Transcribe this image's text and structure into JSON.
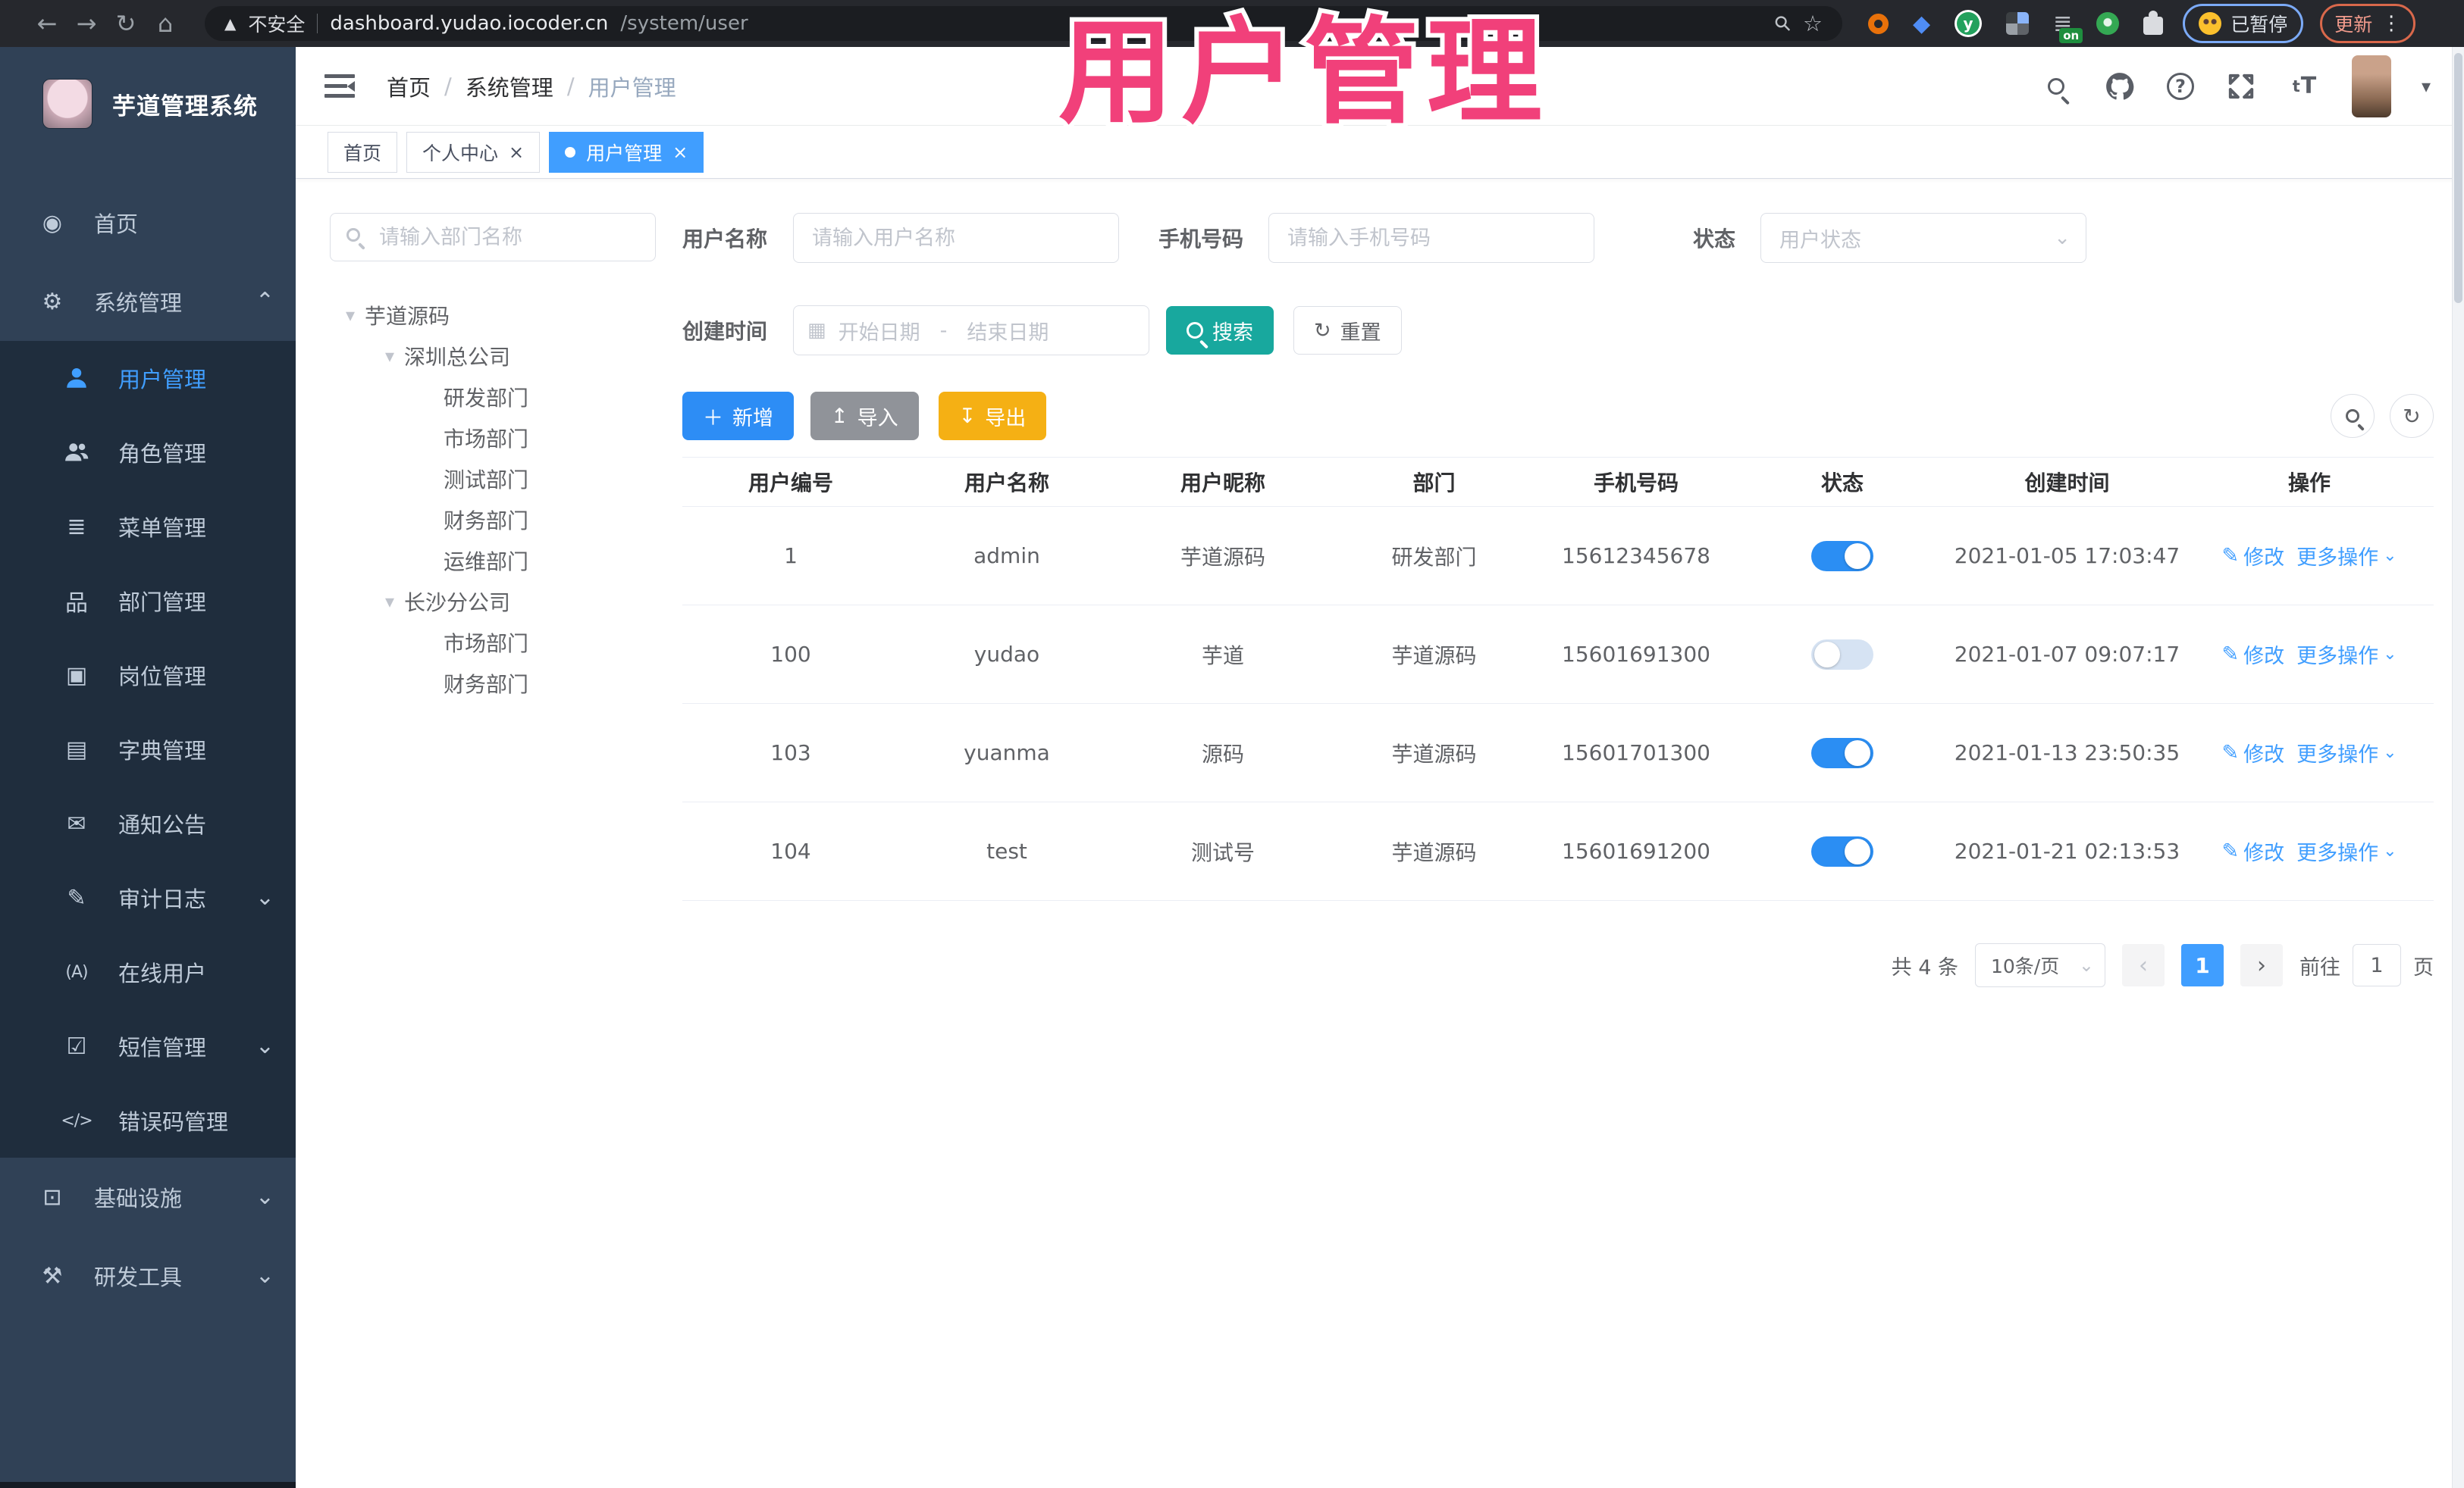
{
  "browser": {
    "security_label": "不安全",
    "url_host": "dashboard.yudao.iocoder.cn",
    "url_path": "/system/user",
    "ext_on_badge": "on",
    "paused_label": "已暂停",
    "update_label": "更新"
  },
  "overlay_title": "用户管理",
  "sidebar": {
    "logo_title": "芋道管理系统",
    "items": [
      {
        "label": "首页",
        "icon": "dashboard-icon",
        "level": 0
      },
      {
        "label": "系统管理",
        "icon": "gear-icon",
        "level": 0,
        "arrow": "up"
      },
      {
        "label": "用户管理",
        "icon": "user-icon",
        "level": 1,
        "active": true
      },
      {
        "label": "角色管理",
        "icon": "users-icon",
        "level": 1
      },
      {
        "label": "菜单管理",
        "icon": "menu-list-icon",
        "level": 1
      },
      {
        "label": "部门管理",
        "icon": "org-tree-icon",
        "level": 1
      },
      {
        "label": "岗位管理",
        "icon": "badge-icon",
        "level": 1
      },
      {
        "label": "字典管理",
        "icon": "dictionary-icon",
        "level": 1
      },
      {
        "label": "通知公告",
        "icon": "announcement-icon",
        "level": 1
      },
      {
        "label": "审计日志",
        "icon": "audit-log-icon",
        "level": 1,
        "arrow": "down"
      },
      {
        "label": "在线用户",
        "icon": "online-user-icon",
        "level": 1
      },
      {
        "label": "短信管理",
        "icon": "sms-icon",
        "level": 1,
        "arrow": "down"
      },
      {
        "label": "错误码管理",
        "icon": "error-code-icon",
        "level": 1
      },
      {
        "label": "基础设施",
        "icon": "infrastructure-icon",
        "level": 0,
        "arrow": "down"
      },
      {
        "label": "研发工具",
        "icon": "dev-tools-icon",
        "level": 0,
        "arrow": "down"
      }
    ]
  },
  "navbar": {
    "breadcrumb": [
      {
        "label": "首页"
      },
      {
        "label": "系统管理"
      },
      {
        "label": "用户管理",
        "current": true
      }
    ]
  },
  "tabs": [
    {
      "label": "首页",
      "active": false,
      "closable": false
    },
    {
      "label": "个人中心",
      "active": false,
      "closable": true
    },
    {
      "label": "用户管理",
      "active": true,
      "closable": true
    }
  ],
  "dept_tree": {
    "search_placeholder": "请输入部门名称",
    "nodes": [
      {
        "label": "芋道源码",
        "level": 0,
        "expandable": true
      },
      {
        "label": "深圳总公司",
        "level": 1,
        "expandable": true
      },
      {
        "label": "研发部门",
        "level": 2
      },
      {
        "label": "市场部门",
        "level": 2
      },
      {
        "label": "测试部门",
        "level": 2
      },
      {
        "label": "财务部门",
        "level": 2
      },
      {
        "label": "运维部门",
        "level": 2
      },
      {
        "label": "长沙分公司",
        "level": 1,
        "expandable": true
      },
      {
        "label": "市场部门",
        "level": 2
      },
      {
        "label": "财务部门",
        "level": 2
      }
    ]
  },
  "filters": {
    "username_label": "用户名称",
    "username_placeholder": "请输入用户名称",
    "mobile_label": "手机号码",
    "mobile_placeholder": "请输入手机号码",
    "status_label": "状态",
    "status_placeholder": "用户状态",
    "create_time_label": "创建时间",
    "date_start_placeholder": "开始日期",
    "date_separator": "-",
    "date_end_placeholder": "结束日期",
    "search_label": "搜索",
    "reset_label": "重置"
  },
  "toolbar": {
    "add_label": "新增",
    "import_label": "导入",
    "export_label": "导出"
  },
  "table": {
    "columns": [
      "用户编号",
      "用户名称",
      "用户昵称",
      "部门",
      "手机号码",
      "状态",
      "创建时间",
      "操作"
    ],
    "edit_label": "修改",
    "more_label": "更多操作",
    "rows": [
      {
        "id": "1",
        "username": "admin",
        "nickname": "芋道源码",
        "dept": "研发部门",
        "mobile": "15612345678",
        "status_on": true,
        "created": "2021-01-05 17:03:47"
      },
      {
        "id": "100",
        "username": "yudao",
        "nickname": "芋道",
        "dept": "芋道源码",
        "mobile": "15601691300",
        "status_on": false,
        "created": "2021-01-07 09:07:17"
      },
      {
        "id": "103",
        "username": "yuanma",
        "nickname": "源码",
        "dept": "芋道源码",
        "mobile": "15601701300",
        "status_on": true,
        "created": "2021-01-13 23:50:35"
      },
      {
        "id": "104",
        "username": "test",
        "nickname": "测试号",
        "dept": "芋道源码",
        "mobile": "15601691200",
        "status_on": true,
        "created": "2021-01-21 02:13:53"
      }
    ]
  },
  "pagination": {
    "total_text": "共 4 条",
    "page_size_text": "10条/页",
    "prev": "‹",
    "current": "1",
    "next": "›",
    "goto_label": "前往",
    "goto_value": "1",
    "page_unit": "页"
  }
}
